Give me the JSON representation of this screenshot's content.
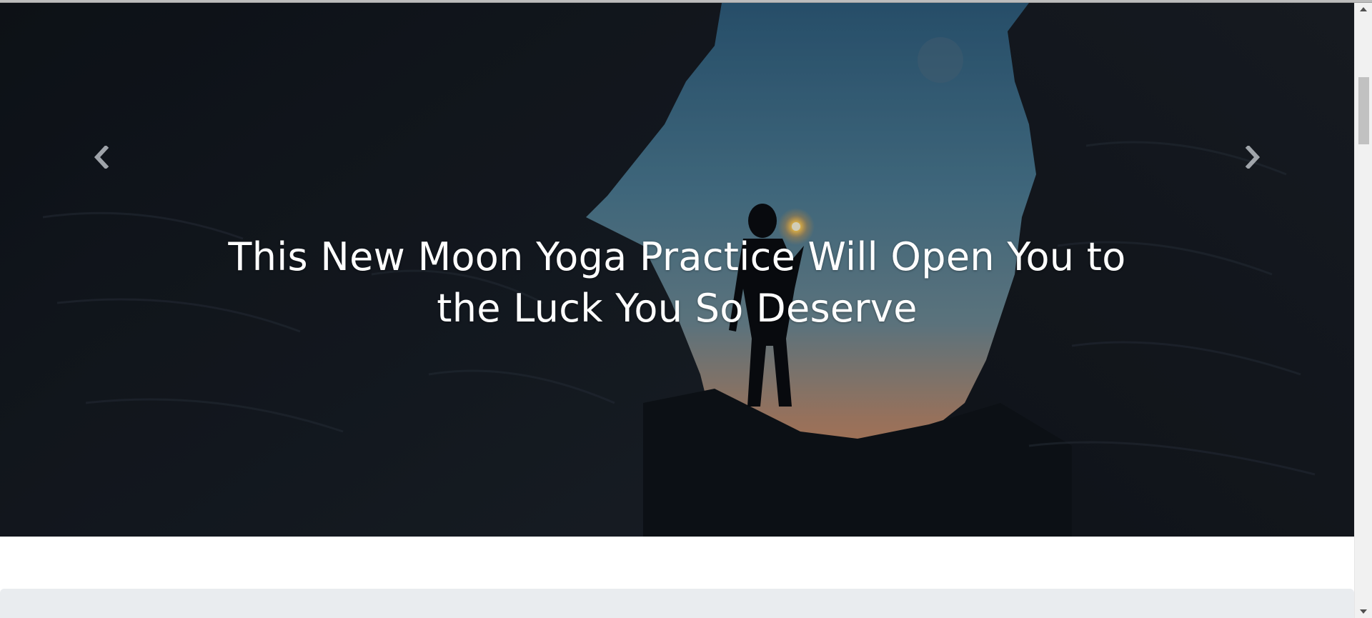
{
  "hero": {
    "headline_line1": "This New Moon Yoga Practice Will Open You to",
    "headline_line2": "the Luck You So Deserve",
    "prev_icon": "chevron-left-icon",
    "next_icon": "chevron-right-icon"
  },
  "colors": {
    "sky_top": "#3a6a8c",
    "sky_bottom": "#d98a5c",
    "rock": "#141a22",
    "jumbotron_bg": "#e9ecef",
    "caption_text": "#ffffff"
  },
  "scrollbar": {
    "up_icon": "scroll-up-arrow-icon",
    "down_icon": "scroll-down-arrow-icon"
  }
}
